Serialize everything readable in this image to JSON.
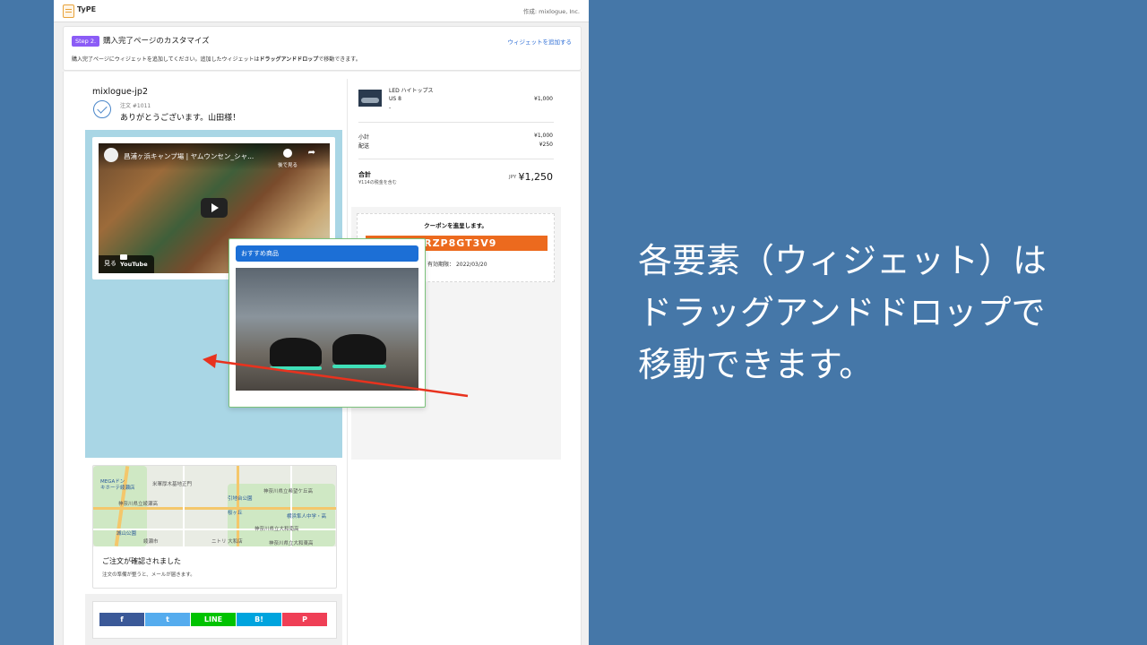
{
  "app": {
    "name": "TyPE",
    "byline": "作成: mixlogue, Inc."
  },
  "step": {
    "badge": "Step 2.",
    "title": "購入完了ページのカスタマイズ",
    "add_widget_link": "ウィジェットを追加する",
    "description_prefix": "購入完了ページにウィジェットを追加してください。追加したウィジェットは",
    "description_bold": "ドラッグアンドドロップ",
    "description_suffix": "で移動できます。"
  },
  "order": {
    "shop_name": "mixlogue-jp2",
    "order_number": "注文 #1011",
    "thanks": "ありがとうございます。山田様！"
  },
  "video": {
    "title": "昌浦ヶ浜キャンプ場 | ヤムウンセン_シャ...",
    "watch_later": "後で見る",
    "share": "共有",
    "watch_label": "見る",
    "youtube": "YouTube"
  },
  "map_widget": {
    "labels": [
      "MEGAドン",
      "キホーテ綾瀬店",
      "米軍厚木基地正門",
      "神奈川県立綾瀬高",
      "神奈川県立希望ケ丘高",
      "引地台公園",
      "桜ヶ丘",
      "綾瀬市",
      "城山公園",
      "横浜隼人中学・高",
      "神奈川県立大和南高",
      "ニトリ 大和店",
      "神奈川県立大和東高"
    ],
    "title": "ご注文が確認されました",
    "subtitle": "注文の準備が整うと、メールが届きます。"
  },
  "share_buttons": [
    {
      "label": "f",
      "color": "#3b5998"
    },
    {
      "label": "t",
      "color": "#55acee"
    },
    {
      "label": "LINE",
      "color": "#00c300"
    },
    {
      "label": "B!",
      "color": "#00a4de"
    },
    {
      "label": "P",
      "color": "#ef3f56"
    }
  ],
  "product": {
    "name": "LED ハイトップス",
    "variant": "US 8",
    "dash": "-",
    "price": "¥1,000"
  },
  "summary": {
    "subtotal_label": "小計",
    "subtotal": "¥1,000",
    "shipping_label": "配送",
    "shipping": "¥250",
    "total_label": "合計",
    "tax_note": "¥114の税金を含む",
    "currency": "JPY",
    "total": "¥1,250"
  },
  "coupon": {
    "title": "クーポンを進呈します。",
    "code": "ERZP8GT3V9",
    "expiry_label": "有効期限：",
    "expiry": "2022/03/20"
  },
  "recommend": {
    "header": "おすすめ商品"
  },
  "caption": {
    "line1": "各要素（ウィジェット）は",
    "line2": "ドラッグアンドドロップで",
    "line3": "移動できます。"
  }
}
